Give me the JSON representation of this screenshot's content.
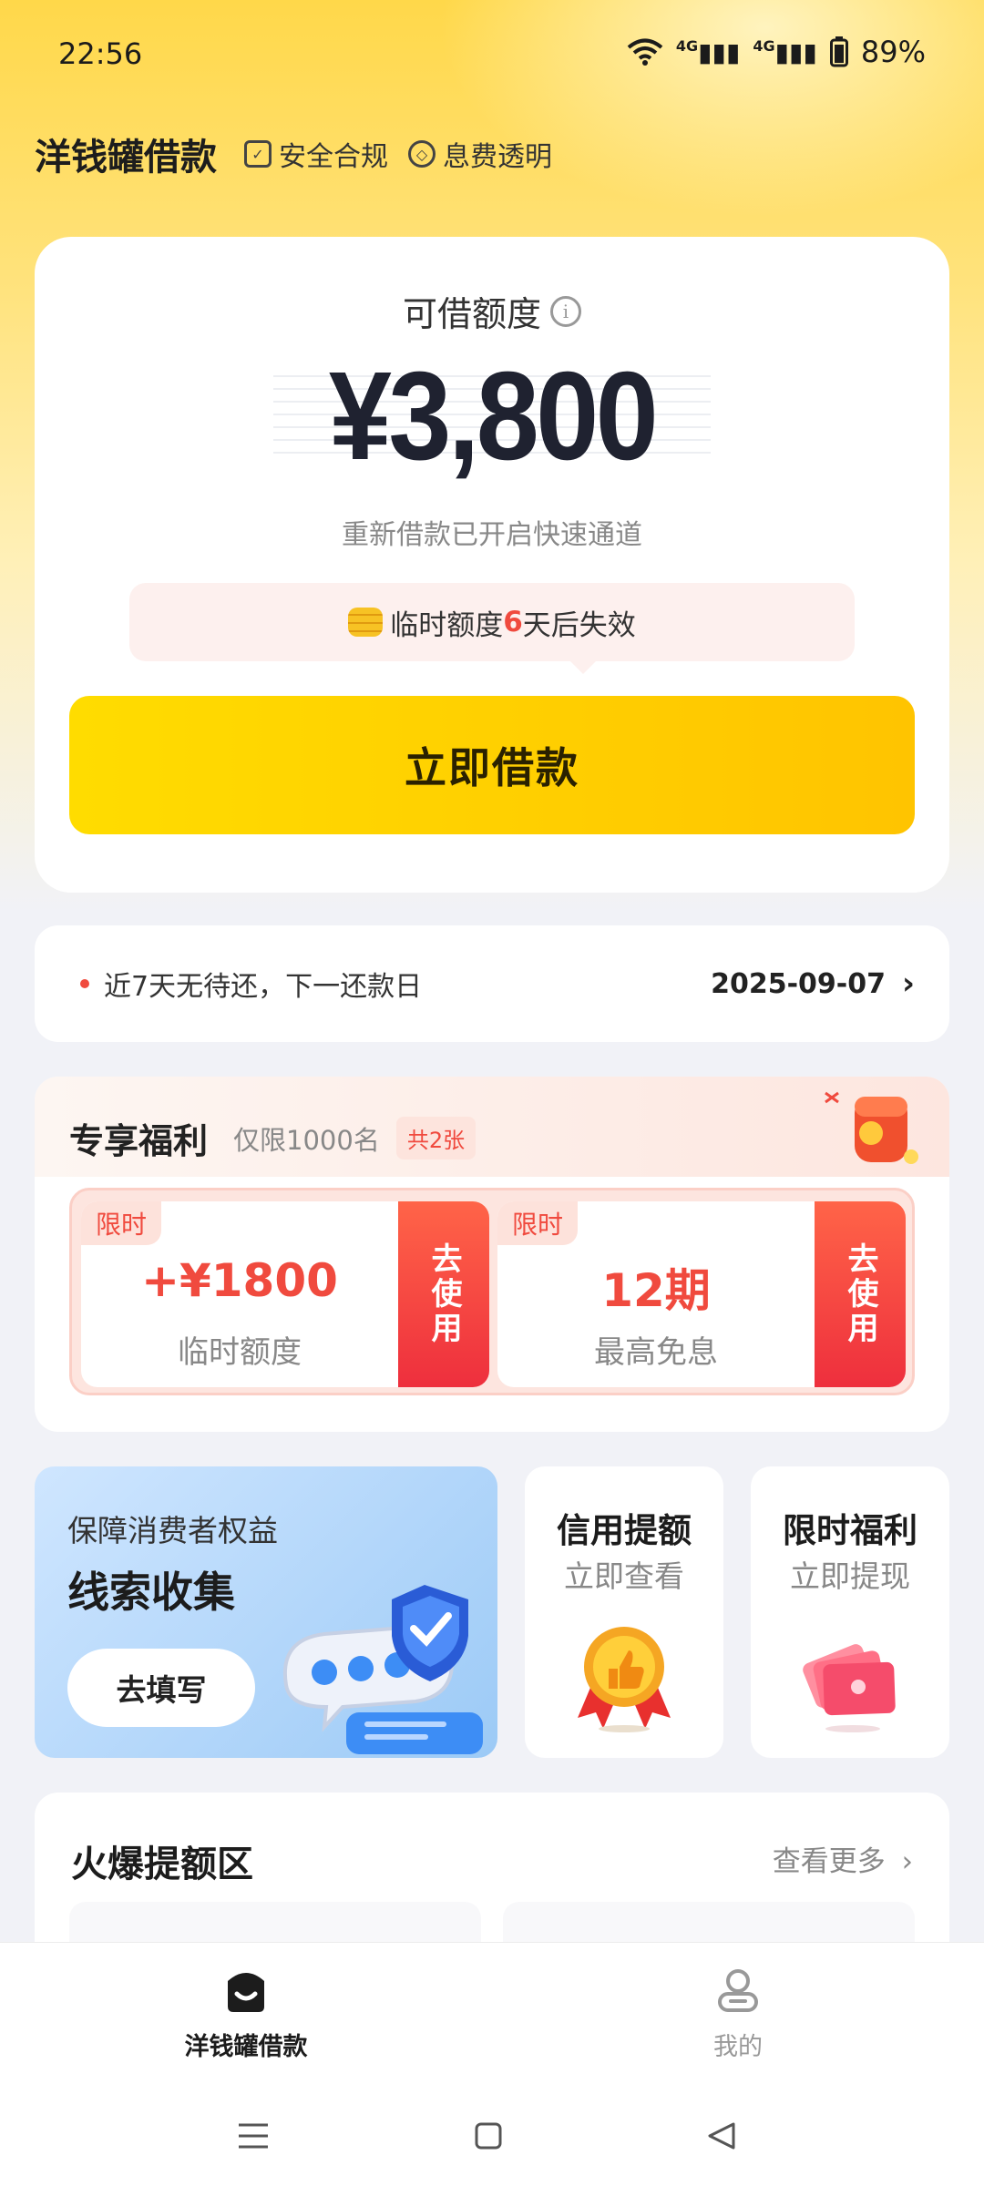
{
  "status_bar": {
    "time": "22:56",
    "signal_1": "4G",
    "signal_2": "4G",
    "battery": "89%"
  },
  "header": {
    "app_title": "洋钱罐借款",
    "tag_safe": "安全合规",
    "tag_fee": "息费透明"
  },
  "credit": {
    "label": "可借额度",
    "amount": "¥3,800",
    "fast_channel": "重新借款已开启快速通道",
    "expire_prefix": "临时额度",
    "expire_days": "6",
    "expire_suffix": "天后失效",
    "borrow_button": "立即借款"
  },
  "repay": {
    "text": "近7天无待还，下一还款日",
    "date": "2025-09-07"
  },
  "benefits": {
    "title": "专享福利",
    "limit": "仅限1000名",
    "count": "共2张",
    "coupons": [
      {
        "badge": "限时",
        "value": "+¥1800",
        "desc": "临时额度",
        "action": "去使用"
      },
      {
        "badge": "限时",
        "value": "12期",
        "desc": "最高免息",
        "action": "去使用"
      }
    ]
  },
  "promo": {
    "feedback_sub": "保障消费者权益",
    "feedback_title": "线索收集",
    "feedback_button": "去填写",
    "credit_up_title": "信用提额",
    "credit_up_sub": "立即查看",
    "limited_title": "限时福利",
    "limited_sub": "立即提现"
  },
  "hot": {
    "title": "火爆提额区",
    "more": "查看更多"
  },
  "bottom_nav": {
    "home": "洋钱罐借款",
    "mine": "我的"
  },
  "colors": {
    "brand_yellow": "#ffc400",
    "accent_red": "#f04a3e",
    "background": "#f1f2f7"
  }
}
